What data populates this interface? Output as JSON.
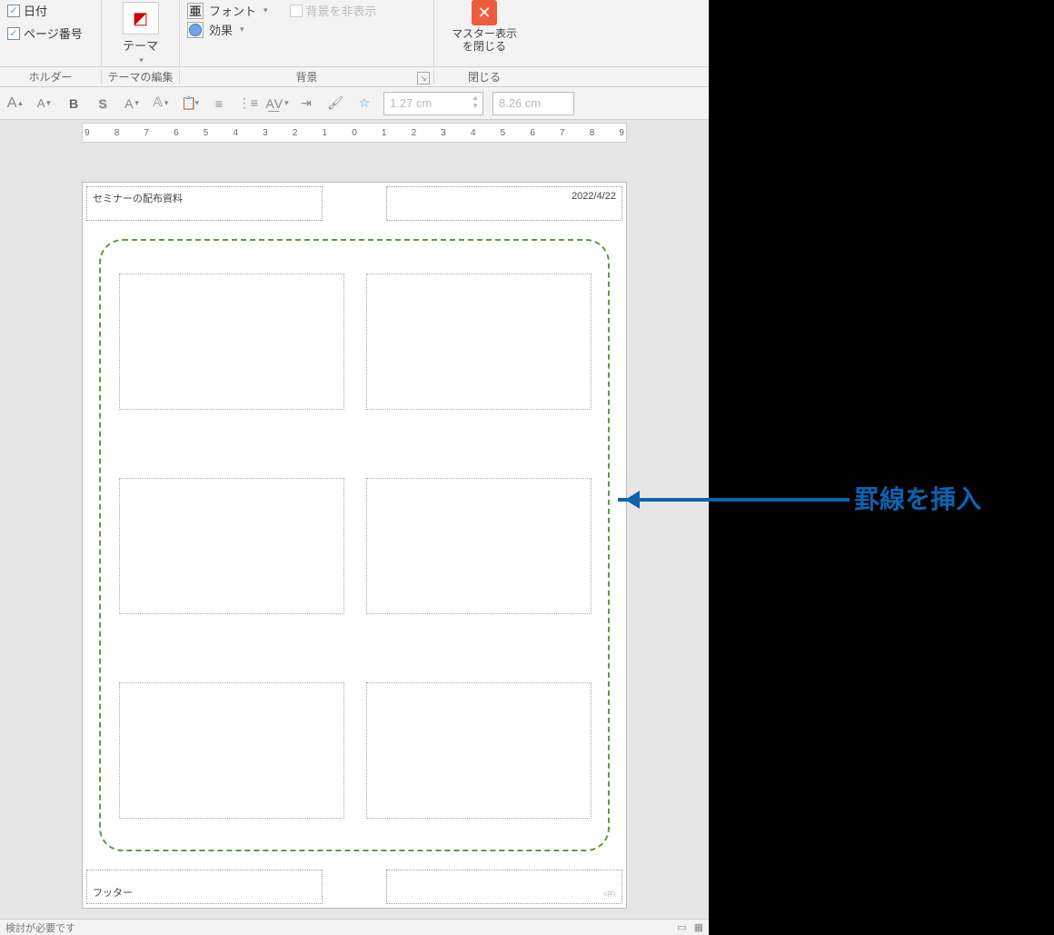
{
  "ribbon": {
    "date_label": "日付",
    "page_number_label": "ページ番号",
    "group_placeholder": "ホルダー",
    "theme_label": "テーマ",
    "group_theme_edit": "テーマの編集",
    "font_label": "フォント",
    "effects_label": "効果",
    "hide_bg_label": "背景を非表示",
    "group_background": "背景",
    "close_master_line1": "マスター表示",
    "close_master_line2": "を閉じる",
    "group_close": "閉じる"
  },
  "toolbar": {
    "grow_font": "A",
    "shrink_font": "A",
    "bold": "B",
    "shadow": "S",
    "spin1": "1.27 cm",
    "spin2": "8.26 cm"
  },
  "ruler": {
    "ticks": [
      "9",
      "8",
      "7",
      "6",
      "5",
      "4",
      "3",
      "2",
      "1",
      "0",
      "1",
      "2",
      "3",
      "4",
      "5",
      "6",
      "7",
      "8",
      "9"
    ]
  },
  "page": {
    "header_left": "セミナーの配布資料",
    "header_right": "2022/4/22",
    "footer_left": "フッター",
    "footer_right": "‹#›"
  },
  "callout": "罫線を挿入",
  "status": {
    "left": "検討が必要です"
  }
}
